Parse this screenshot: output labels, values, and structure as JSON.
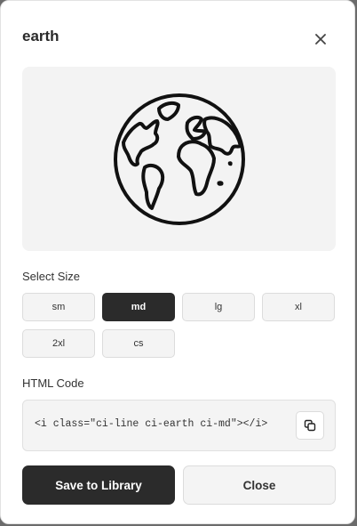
{
  "modal": {
    "title": "earth",
    "icon": "earth-globe-icon",
    "close_icon": "close-icon"
  },
  "size": {
    "label": "Select Size",
    "options": [
      "sm",
      "md",
      "lg",
      "xl",
      "2xl",
      "cs"
    ],
    "selected": "md"
  },
  "code": {
    "label": "HTML Code",
    "snippet": "<i class=\"ci-line ci-earth ci-md\"></i>",
    "copy_icon": "copy-icon"
  },
  "actions": {
    "save_label": "Save to Library",
    "close_label": "Close"
  },
  "colors": {
    "primary": "#2b2b2b",
    "surface": "#f4f4f4",
    "border": "#dcdcdc"
  }
}
